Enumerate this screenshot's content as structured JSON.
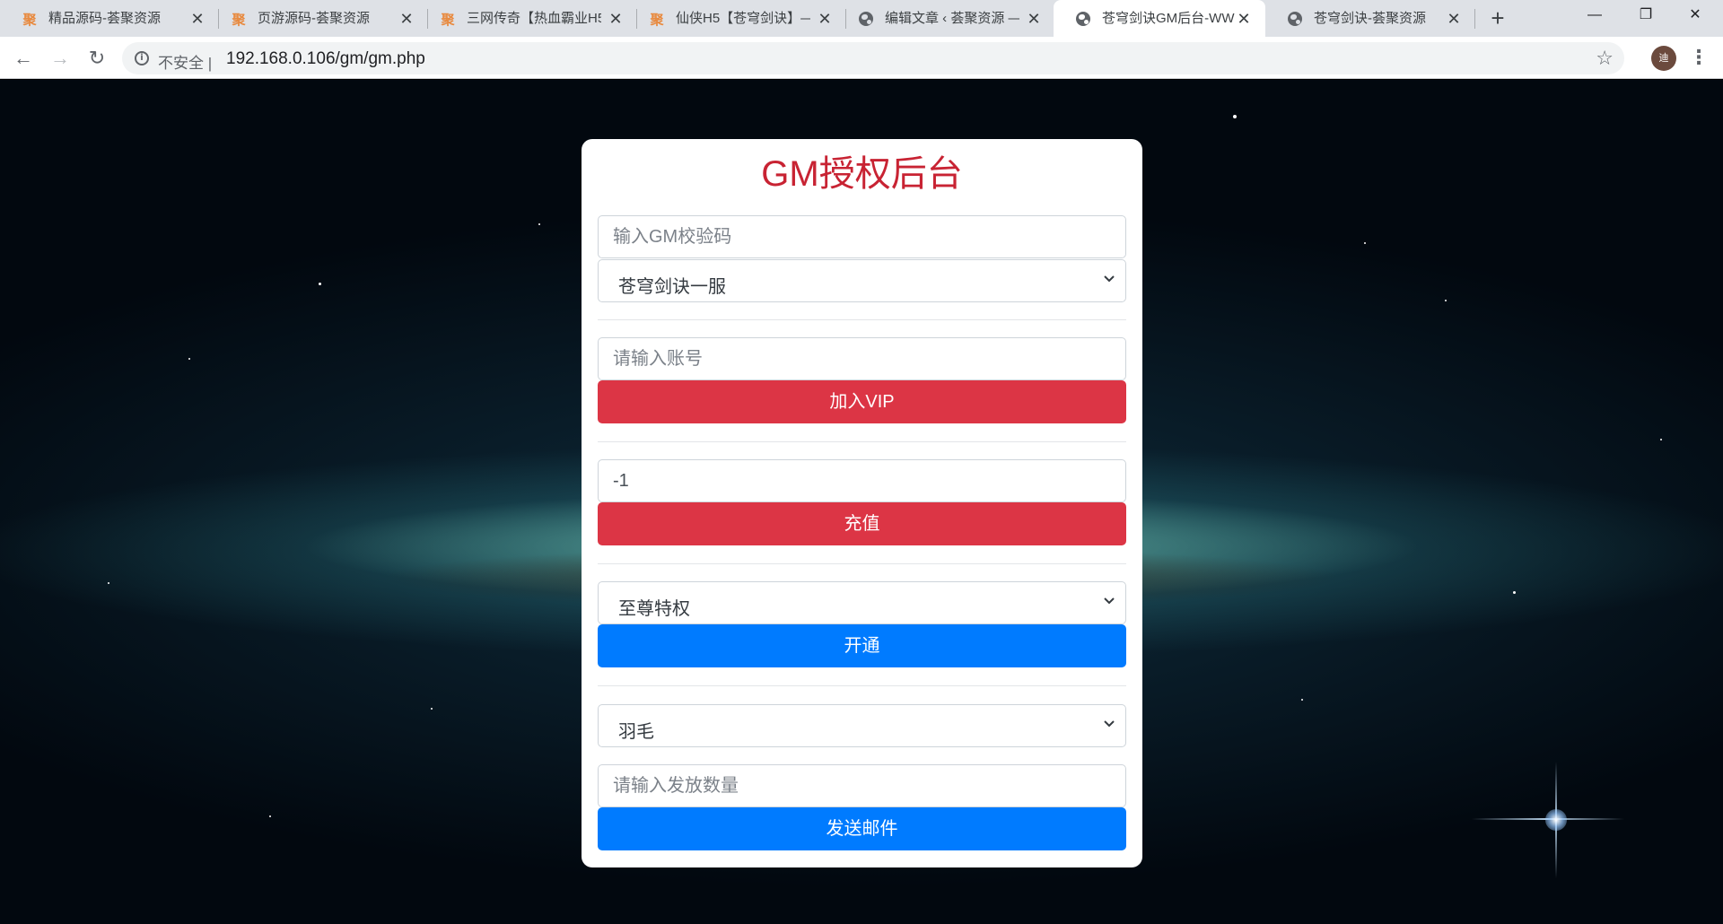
{
  "browser": {
    "tabs": [
      {
        "title": "精品源码-荟聚资源",
        "favicon": "聚",
        "icon": "ju-favicon",
        "active": false
      },
      {
        "title": "页游源码-荟聚资源",
        "favicon": "聚",
        "icon": "ju-favicon",
        "active": false
      },
      {
        "title": "三网传奇【热血霸业H5",
        "favicon": "聚",
        "icon": "ju-favicon",
        "active": false
      },
      {
        "title": "仙侠H5【苍穹剑诀】—",
        "favicon": "聚",
        "icon": "ju-favicon",
        "active": false
      },
      {
        "title": "编辑文章 ‹ 荟聚资源 —",
        "favicon": "",
        "icon": "globe-icon",
        "active": false
      },
      {
        "title": "苍穹剑诀GM后台-WW",
        "favicon": "",
        "icon": "globe-icon",
        "active": true
      },
      {
        "title": "苍穹剑诀-荟聚资源",
        "favicon": "",
        "icon": "globe-icon",
        "active": false
      }
    ],
    "tab_close": "✕",
    "new_tab": "+",
    "window_controls": {
      "minimize": "—",
      "maximize": "❐",
      "close": "✕"
    },
    "nav": {
      "back": "←",
      "forward": "→",
      "reload": "↻"
    },
    "security_label": "不安全",
    "separator": "|",
    "url": "192.168.0.106/gm/gm.php",
    "bookmark_star": "☆",
    "profile_initial": "迪",
    "menu": "⋮"
  },
  "form": {
    "title": "GM授权后台",
    "gm_code": {
      "placeholder": "输入GM校验码",
      "value": ""
    },
    "server_select": {
      "value": "苍穹剑诀一服"
    },
    "account": {
      "placeholder": "请输入账号",
      "value": ""
    },
    "vip_button": "加入VIP",
    "recharge_amount": {
      "value": "-1"
    },
    "recharge_button": "充值",
    "privilege_select": {
      "value": "至尊特权"
    },
    "open_button": "开通",
    "item_select": {
      "value": "羽毛"
    },
    "item_quantity": {
      "placeholder": "请输入发放数量",
      "value": ""
    },
    "mail_button": "发送邮件",
    "caret": "⌄"
  },
  "colors": {
    "title_red": "#c82333",
    "button_red": "#dc3545",
    "button_blue": "#007bff"
  }
}
